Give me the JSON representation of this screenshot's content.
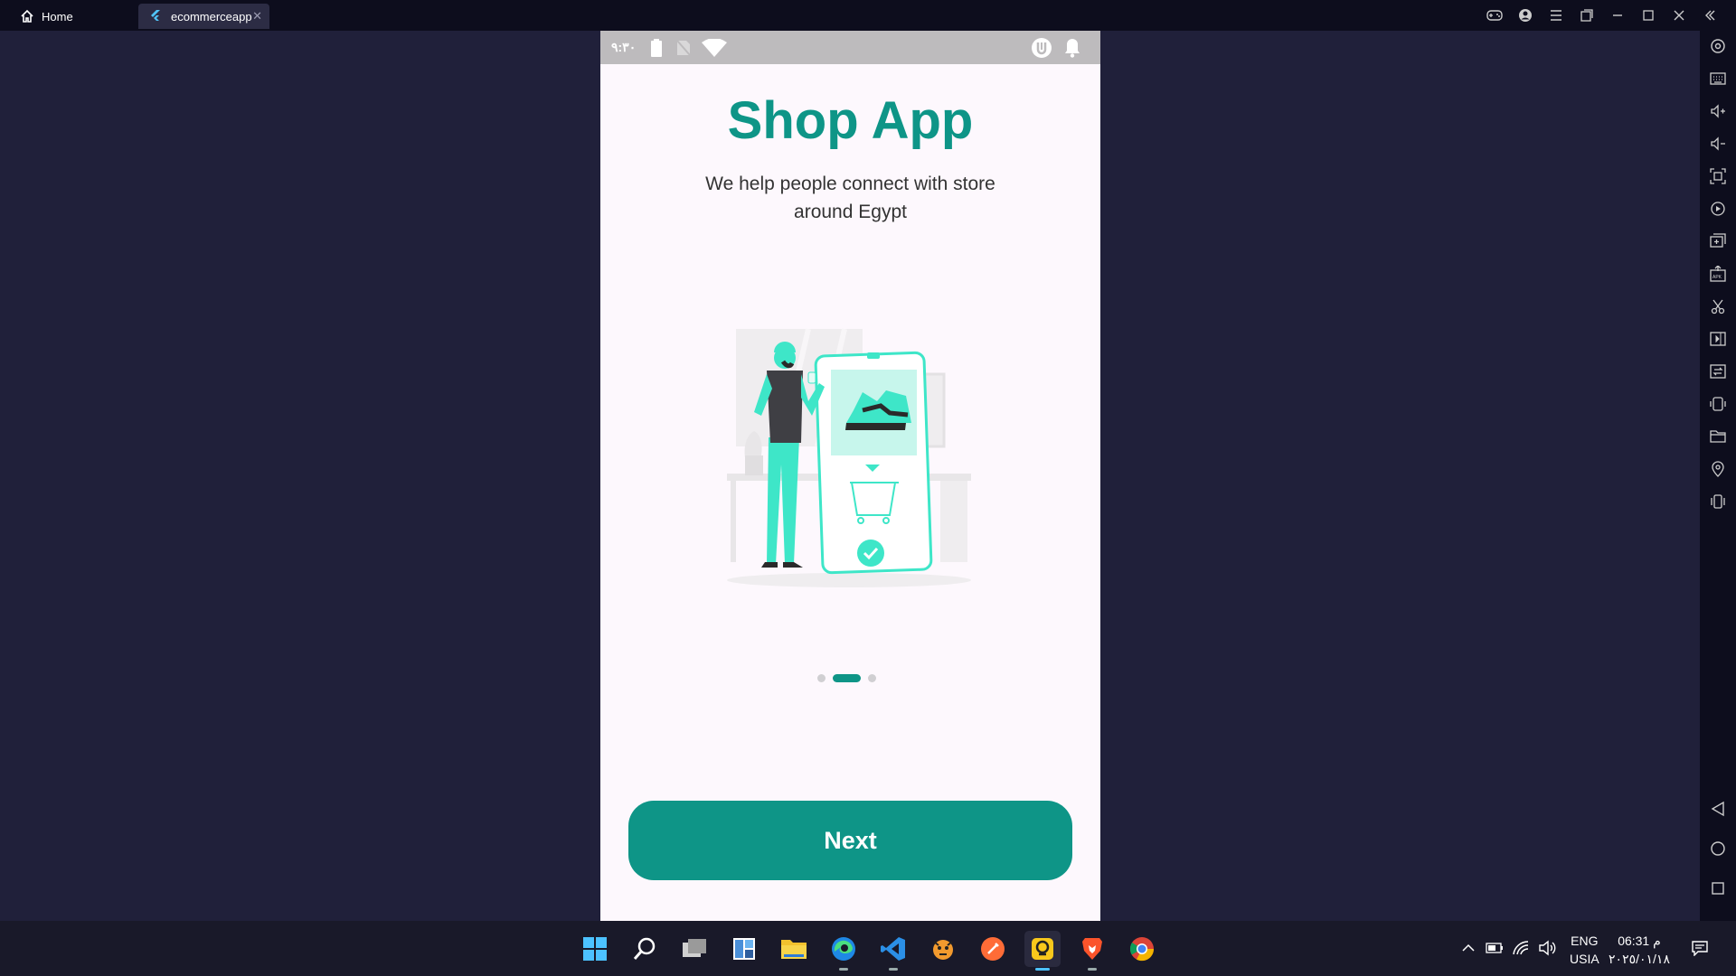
{
  "window": {
    "tabs": [
      {
        "label": "Home",
        "icon": "home-icon"
      },
      {
        "label": "ecommerceapp",
        "icon": "flutter-icon",
        "active": true
      }
    ],
    "controls": [
      "gamepad-icon",
      "account-icon",
      "menu-icon",
      "restore-window-icon",
      "minimize-icon",
      "maximize-icon",
      "close-icon",
      "collapse-sidebar-icon"
    ]
  },
  "right_toolbar": {
    "items": [
      "settings-icon",
      "keyboard-icon",
      "volume-up-icon",
      "volume-down-icon",
      "screenshot-icon",
      "record-icon",
      "multi-instance-icon",
      "install-apk-icon",
      "scissors-icon",
      "video-icon",
      "file-transfer-icon",
      "rotate-icon",
      "folder-icon",
      "location-icon",
      "shake-icon"
    ],
    "nav": [
      "back-icon",
      "home-circle-icon",
      "recents-icon"
    ]
  },
  "phone": {
    "status_bar": {
      "time": "٩:٣٠",
      "icons": [
        "battery-icon",
        "no-sim-icon",
        "wifi-icon",
        "app-badge-icon",
        "notification-bell-icon"
      ]
    },
    "title": "Shop App",
    "subtitle": "We help people connect with store around Egypt",
    "illustration": "person shopping for sneakers on a phone",
    "pager": {
      "count": 3,
      "active_index": 1
    },
    "next_button": "Next",
    "colors": {
      "primary": "#0e9587",
      "accent": "#3ee6c8",
      "background": "#fdf8fd"
    }
  },
  "taskbar": {
    "apps": [
      "windows-start-icon",
      "search-icon",
      "task-view-icon",
      "widgets-icon",
      "file-explorer-icon",
      "edge-icon",
      "vscode-icon",
      "app-icon",
      "postman-icon",
      "ldplayer-icon",
      "brave-icon",
      "chrome-icon"
    ],
    "tray": {
      "language": "ENG",
      "region": "USIA",
      "time": "06:31 م",
      "date": "٢٠٢٥/٠١/١٨"
    }
  }
}
